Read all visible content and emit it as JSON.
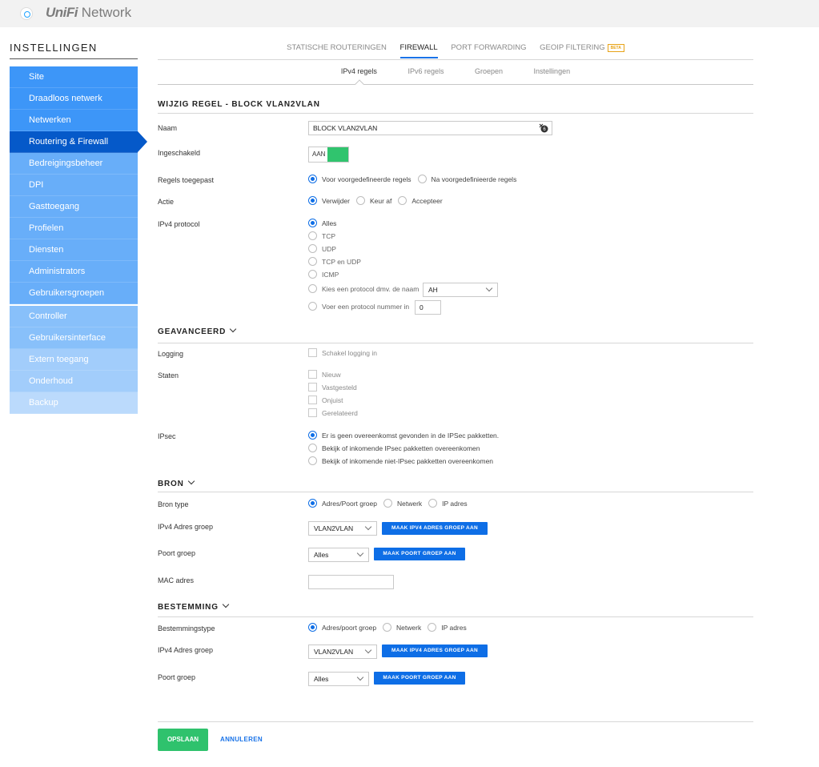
{
  "app": {
    "brand_part1": "UniFi",
    "brand_part2": " Network"
  },
  "sidebar": {
    "title": "INSTELLINGEN",
    "items": [
      {
        "label": "Site"
      },
      {
        "label": "Draadloos netwerk"
      },
      {
        "label": "Netwerken"
      },
      {
        "label": "Routering & Firewall"
      },
      {
        "label": "Bedreigingsbeheer"
      },
      {
        "label": "DPI"
      },
      {
        "label": "Gasttoegang"
      },
      {
        "label": "Profielen"
      },
      {
        "label": "Diensten"
      },
      {
        "label": "Administrators"
      },
      {
        "label": "Gebruikersgroepen"
      }
    ],
    "items2": [
      {
        "label": "Controller"
      },
      {
        "label": "Gebruikersinterface"
      },
      {
        "label": "Extern toegang"
      },
      {
        "label": "Onderhoud"
      },
      {
        "label": "Backup"
      }
    ]
  },
  "tabs": [
    {
      "label": "STATISCHE ROUTERINGEN"
    },
    {
      "label": "FIREWALL"
    },
    {
      "label": "PORT FORWARDING"
    },
    {
      "label": "GEOIP FILTERING",
      "badge": "BETA"
    }
  ],
  "subtabs": [
    {
      "label": "IPv4 regels"
    },
    {
      "label": "IPv6 regels"
    },
    {
      "label": "Groepen"
    },
    {
      "label": "Instellingen"
    }
  ],
  "form": {
    "title": "WIJZIG REGEL - BLOCK VLAN2VLAN",
    "name_label": "Naam",
    "name_value": "BLOCK VLAN2VLAN",
    "enabled_label": "Ingeschakeld",
    "enabled_value": "AAN",
    "rules_applied_label": "Regels toegepast",
    "rules_applied_options": [
      "Voor voorgedefineerde regels",
      "Na voorgedefinieerde regels"
    ],
    "action_label": "Actie",
    "action_options": [
      "Verwijder",
      "Keur af",
      "Accepteer"
    ],
    "protocol_label": "IPv4 protocol",
    "protocol_options": [
      "Alles",
      "TCP",
      "UDP",
      "TCP en UDP",
      "ICMP",
      "Kies een protocol dmv. de naam",
      "Voer een protocol nummer in"
    ],
    "protocol_name_value": "AH",
    "protocol_number_value": "0"
  },
  "advanced": {
    "title": "GEAVANCEERD",
    "logging_label": "Logging",
    "logging_option": "Schakel logging in",
    "states_label": "Staten",
    "states_options": [
      "Nieuw",
      "Vastgesteld",
      "Onjuist",
      "Gerelateerd"
    ],
    "ipsec_label": "IPsec",
    "ipsec_options": [
      "Er is geen overeenkomst gevonden in de IPSec pakketten.",
      "Bekijk of inkomende IPsec pakketten overeenkomen",
      "Bekijk of inkomende niet-IPsec pakketten overeenkomen"
    ]
  },
  "source": {
    "title": "BRON",
    "type_label": "Bron type",
    "type_options": [
      "Adres/Poort groep",
      "Netwerk",
      "IP adres"
    ],
    "ipv4_group_label": "IPv4 Adres groep",
    "ipv4_group_value": "VLAN2VLAN",
    "ipv4_group_button": "MAAK IPV4 ADRES GROEP AAN",
    "port_group_label": "Poort groep",
    "port_group_value": "Alles",
    "port_group_button": "MAAK POORT GROEP AAN",
    "mac_label": "MAC adres",
    "mac_value": ""
  },
  "destination": {
    "title": "BESTEMMING",
    "type_label": "Bestemmingstype",
    "type_options": [
      "Adres/poort groep",
      "Netwerk",
      "IP adres"
    ],
    "ipv4_group_label": "IPv4 Adres groep",
    "ipv4_group_value": "VLAN2VLAN",
    "ipv4_group_button": "MAAK IPV4 ADRES GROEP AAN",
    "port_group_label": "Poort groep",
    "port_group_value": "Alles",
    "port_group_button": "MAAK POORT GROEP AAN"
  },
  "footer": {
    "save": "OPSLAAN",
    "cancel": "ANNULEREN"
  },
  "colors": {
    "accent": "#0e6ee6",
    "success": "#2fc26d",
    "sidebar_active": "#0559c9",
    "beta": "#e8a317"
  }
}
